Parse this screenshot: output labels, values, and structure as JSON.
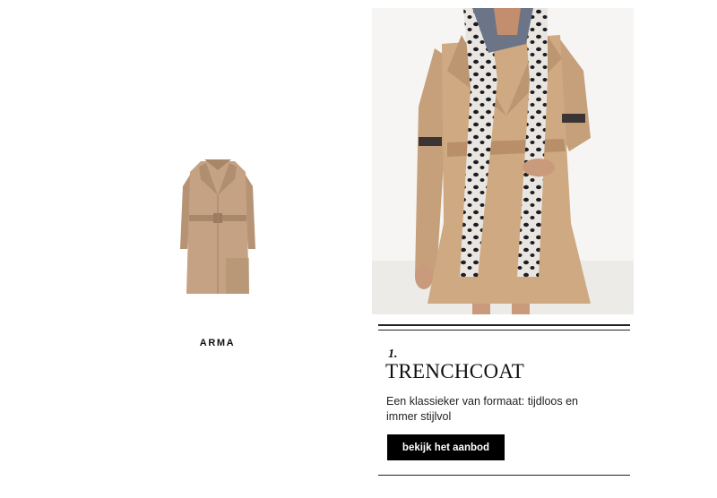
{
  "product": {
    "brand": "ARMA",
    "image_icon": "suede-coat-thumbnail"
  },
  "hero": {
    "image_icon": "model-in-trenchcoat-with-scarf"
  },
  "feature": {
    "number": "1.",
    "title": "TRENCHCOAT",
    "description": "Een klassieker van formaat: tijdloos en immer stijlvol",
    "cta_label": "bekijk het aanbod"
  },
  "colors": {
    "button_bg": "#000000",
    "button_text": "#ffffff",
    "rule": "#222222",
    "coat_tan": "#c8a27b"
  }
}
